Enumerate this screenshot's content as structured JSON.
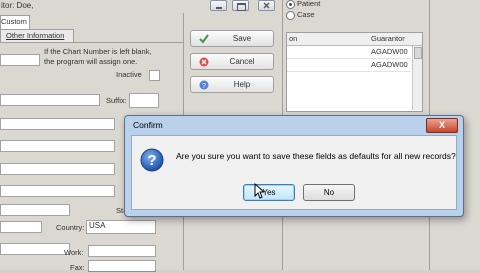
{
  "header": {
    "title_fragment": "itor: Doe,"
  },
  "tabs": {
    "custom": "Custom",
    "other_info": "Other Information"
  },
  "note": {
    "line1": "If the Chart Number is left blank,",
    "line2": "the program will assign one."
  },
  "form": {
    "inactive_label": "Inactive",
    "suffix_label": "Suffix:",
    "state_label_partial": "Sta",
    "country_label": "Country:",
    "country_value": "USA",
    "work_label": "Work:",
    "fax_label": "Fax:"
  },
  "buttons": {
    "save": "Save",
    "cancel": "Cancel",
    "help": "Help"
  },
  "radios": {
    "patient": "Patient",
    "case": "Case"
  },
  "grid": {
    "col1_partial": "on",
    "col2": "Guarantor",
    "rows": [
      "AGADW00",
      "AGADW00"
    ]
  },
  "dialog": {
    "title": "Confirm",
    "close": "X",
    "message": "Are you sure you want to save these fields as defaults for all new records?",
    "yes": "Yes",
    "no": "No"
  },
  "colors": {
    "dialog_frame": "#b9d1ea",
    "close_red": "#c8452f",
    "window_bg": "#d4d0c8"
  }
}
